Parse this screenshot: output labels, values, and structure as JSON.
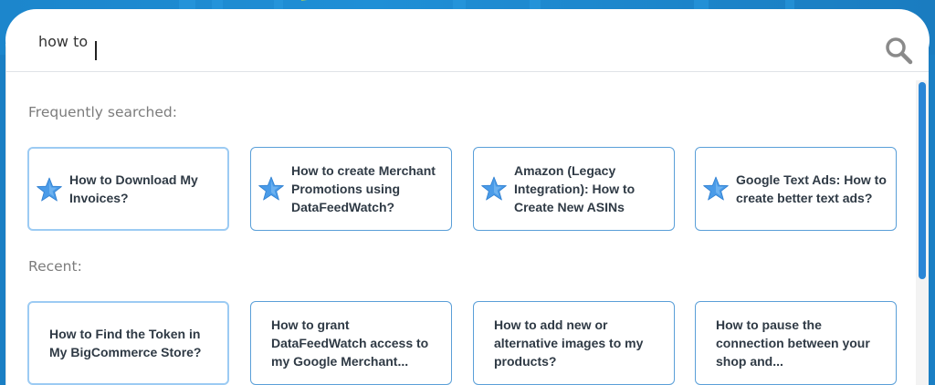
{
  "search": {
    "value": "how to",
    "icon": "search-icon"
  },
  "frequently": {
    "title": "Frequently searched:",
    "items": [
      {
        "label": "How to Download My Invoices?",
        "icon": "star-icon"
      },
      {
        "label": "How to create Merchant Promotions using DataFeedWatch?",
        "icon": "star-icon"
      },
      {
        "label": "Amazon (Legacy Integration): How to Create New ASINs",
        "icon": "star-icon"
      },
      {
        "label": "Google Text Ads: How to create better text ads?",
        "icon": "star-icon"
      }
    ]
  },
  "recent": {
    "title": "Recent:",
    "items": [
      {
        "label": "How to Find the Token in My BigCommerce Store?"
      },
      {
        "label": "How to grant DataFeedWatch access to my Google Merchant..."
      },
      {
        "label": "How to add new or alternative images to my products?"
      },
      {
        "label": "How to pause the connection between your shop and..."
      }
    ]
  },
  "colors": {
    "accent": "#2a86d6",
    "card_border": "#5a9fd8",
    "star": "#4a9be8",
    "background": "#1a7fc4"
  }
}
